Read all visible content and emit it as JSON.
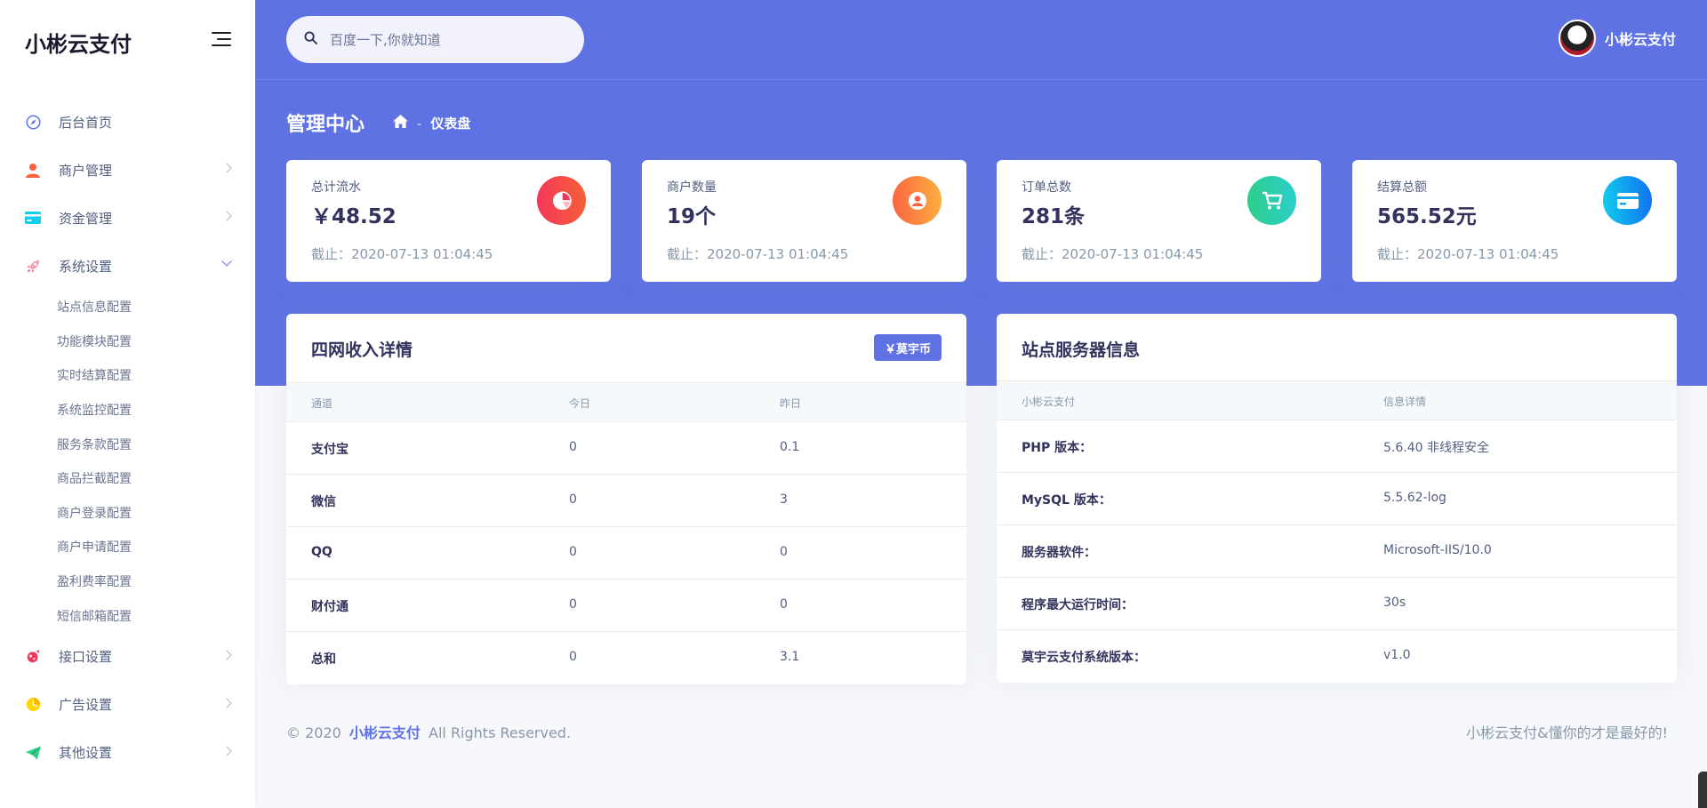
{
  "sidebar": {
    "brand": "小彬云支付",
    "items": [
      {
        "label": "后台首页"
      },
      {
        "label": "商户管理"
      },
      {
        "label": "资金管理"
      },
      {
        "label": "系统设置"
      },
      {
        "label": "接口设置"
      },
      {
        "label": "广告设置"
      },
      {
        "label": "其他设置"
      }
    ],
    "subitems": [
      "站点信息配置",
      "功能模块配置",
      "实时结算配置",
      "系统监控配置",
      "服务条款配置",
      "商品拦截配置",
      "商户登录配置",
      "商户申请配置",
      "盈利费率配置",
      "短信邮箱配置"
    ]
  },
  "header": {
    "search_placeholder": "百度一下,你就知道",
    "user_name": "小彬云支付",
    "page_title": "管理中心",
    "breadcrumb_sep": "-",
    "breadcrumb_current": "仪表盘"
  },
  "stats": [
    {
      "label": "总计流水",
      "value": "￥48.52",
      "foot": "截止：2020-07-13 01:04:45",
      "color": "#f5365c"
    },
    {
      "label": "商户数量",
      "value": "19个",
      "foot": "截止：2020-07-13 01:04:45",
      "color": "#fb6340"
    },
    {
      "label": "订单总数",
      "value": "281条",
      "foot": "截止：2020-07-13 01:04:45",
      "color": "#2dce89"
    },
    {
      "label": "结算总额",
      "value": "565.52元",
      "foot": "截止：2020-07-13 01:04:45",
      "color": "#11cdef"
    }
  ],
  "income": {
    "title": "四网收入详情",
    "badge": "￥莫宇币",
    "headers": [
      "通道",
      "今日",
      "昨日"
    ],
    "rows": [
      [
        "支付宝",
        "0",
        "0.1"
      ],
      [
        "微信",
        "0",
        "3"
      ],
      [
        "QQ",
        "0",
        "0"
      ],
      [
        "财付通",
        "0",
        "0"
      ],
      [
        "总和",
        "0",
        "3.1"
      ]
    ]
  },
  "server": {
    "title": "站点服务器信息",
    "headers": [
      "小彬云支付",
      "信息详情"
    ],
    "rows": [
      [
        "PHP 版本：",
        "5.6.40 非线程安全"
      ],
      [
        "MySQL 版本：",
        "5.5.62-log"
      ],
      [
        "服务器软件：",
        "Microsoft-IIS/10.0"
      ],
      [
        "程序最大运行时间：",
        "30s"
      ],
      [
        "莫宇云支付系统版本：",
        "v1.0"
      ]
    ]
  },
  "footer": {
    "copyright": "© 2020",
    "brand": "小彬云支付",
    "rights": "All Rights Reserved.",
    "slogan": "小彬云支付&懂你的才是最好的!"
  },
  "colors": {
    "primary": "#5e72e4",
    "danger": "#f5365c",
    "warning": "#fb6340",
    "success": "#2dce89",
    "info": "#11cdef"
  },
  "icons": {
    "sidebar": [
      "compass-icon",
      "user-icon",
      "credit-card-icon",
      "rocket-icon",
      "plug-icon",
      "chart-pie-icon",
      "paper-plane-icon"
    ],
    "stats": [
      "chart-pie-icon",
      "user-circle-icon",
      "cart-icon",
      "credit-card-icon"
    ],
    "header": [
      "search-icon",
      "home-icon",
      "menu-icon"
    ]
  }
}
